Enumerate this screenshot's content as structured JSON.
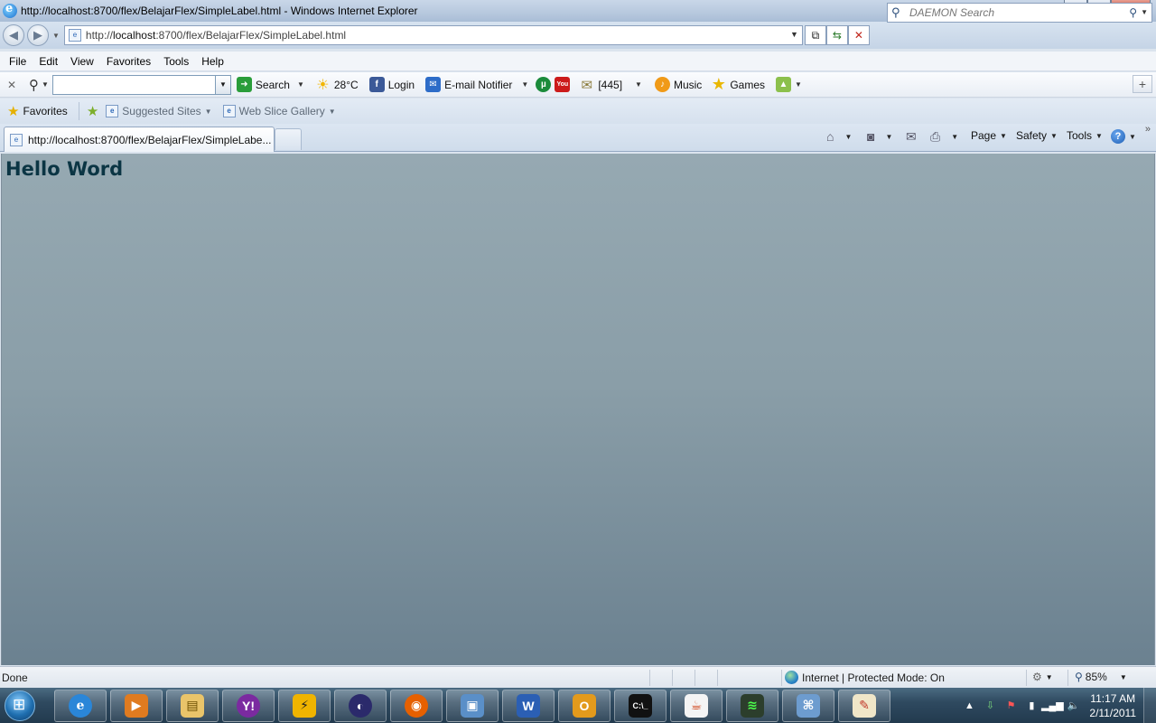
{
  "window": {
    "title": "http://localhost:8700/flex/BelajarFlex/SimpleLabel.html - Windows Internet Explorer",
    "minimize": "–",
    "maximize": "❐",
    "close": "✕"
  },
  "address": {
    "url_prefix": "http://",
    "url_host": "localhost",
    "url_rest": ":8700/flex/BelajarFlex/SimpleLabel.html"
  },
  "search": {
    "placeholder": "DAEMON Search"
  },
  "menu": [
    "File",
    "Edit",
    "View",
    "Favorites",
    "Tools",
    "Help"
  ],
  "toolbar": {
    "search_label": "Search",
    "weather": "28°C",
    "login": "Login",
    "email": "E-mail Notifier",
    "count": "[445]",
    "music": "Music",
    "games": "Games"
  },
  "favorites": {
    "favorites_label": "Favorites",
    "suggested": "Suggested Sites",
    "webslice": "Web Slice Gallery"
  },
  "tab": {
    "label": "http://localhost:8700/flex/BelajarFlex/SimpleLabe..."
  },
  "commandbar": {
    "page": "Page",
    "safety": "Safety",
    "tools": "Tools"
  },
  "content": {
    "label": "Hello Word"
  },
  "status": {
    "text": "Done",
    "zone": "Internet | Protected Mode: On",
    "zoom": "85%"
  },
  "taskbar": {
    "time": "11:17 AM",
    "date": "2/11/2011",
    "apps": [
      "internet-explorer",
      "media-player",
      "file-explorer",
      "yahoo-messenger",
      "winamp",
      "eclipse",
      "firefox",
      "virtualbox",
      "word",
      "outlook",
      "command-prompt",
      "java",
      "task-manager",
      "network",
      "paint"
    ]
  },
  "colors": {
    "content_top": "#96a9b2",
    "content_bottom": "#6b8190",
    "label_color": "#0b3544"
  }
}
